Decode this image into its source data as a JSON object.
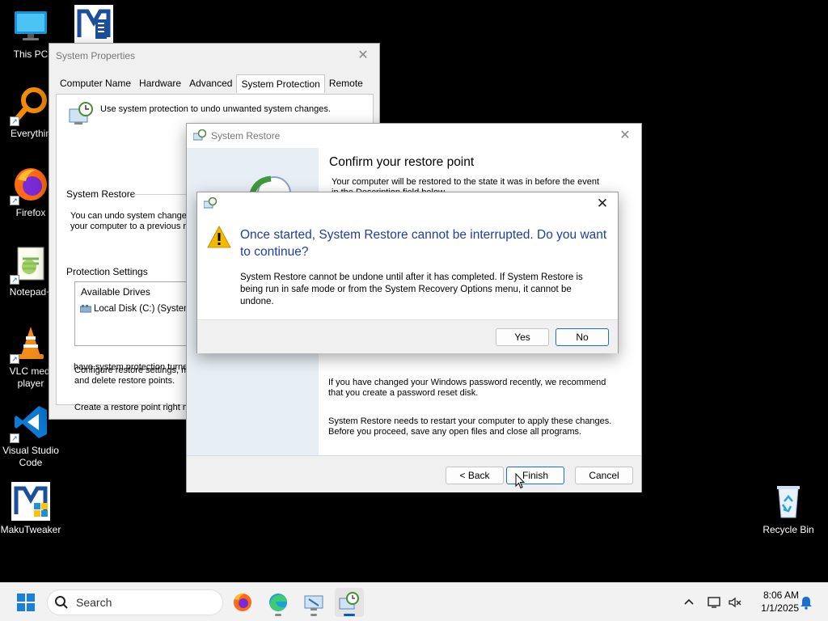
{
  "desktop": {
    "icons": [
      {
        "label": "This PC"
      },
      {
        "label": "Everythin"
      },
      {
        "label": "Firefox"
      },
      {
        "label": "Notepad+"
      },
      {
        "label": "VLC medi player"
      },
      {
        "label": "Visual Studio Code"
      },
      {
        "label": "MakuTweaker"
      },
      {
        "label": "Recycle Bin"
      }
    ]
  },
  "system_properties": {
    "title": "System Properties",
    "tabs": [
      "Computer Name",
      "Hardware",
      "Advanced",
      "System Protection",
      "Remote"
    ],
    "active_tab": "System Protection",
    "intro": "Use system protection to undo unwanted system changes.",
    "system_restore_label": "System Restore",
    "system_restore_text_1": "You can undo system changes",
    "system_restore_text_2": "your computer to a previous res",
    "protection_settings_label": "Protection Settings",
    "available_drives_header": "Available Drives",
    "drive": "Local Disk (C:) (System)",
    "configure_text_1": "Configure restore settings, ma",
    "configure_text_2": "and delete restore points.",
    "create_text_1": "Create a restore point right no",
    "create_text_2": "have system protection turned"
  },
  "system_restore": {
    "title": "System Restore",
    "heading": "Confirm your restore point",
    "line1": "Your computer will be restored to the state it was in before the event",
    "line2": "in the Description field below.",
    "password_1": "If you have changed your Windows password recently, we recommend",
    "password_2": "that you create a password reset disk.",
    "restart_1": "System Restore needs to restart your computer to apply these changes.",
    "restart_2": "Before you proceed, save any open files and close all programs.",
    "back_label": "< Back",
    "finish_label": "Finish",
    "cancel_label": "Cancel"
  },
  "dialog": {
    "question_1": "Once started, System Restore cannot be interrupted. Do you want",
    "question_2": "to continue?",
    "body_1": "System Restore cannot be undone until after it has completed. If System Restore is",
    "body_2": "being run in safe mode or from the System Recovery Options menu, it cannot be",
    "body_3": "undone.",
    "yes_label": "Yes",
    "no_label": "No"
  },
  "taskbar": {
    "search_placeholder": "Search",
    "time": "8:06 AM",
    "date": "1/1/2025"
  },
  "colors": {
    "accent": "#1a6fd1",
    "dialog_title": "#1e3f9a",
    "warning": "#f5b800"
  }
}
